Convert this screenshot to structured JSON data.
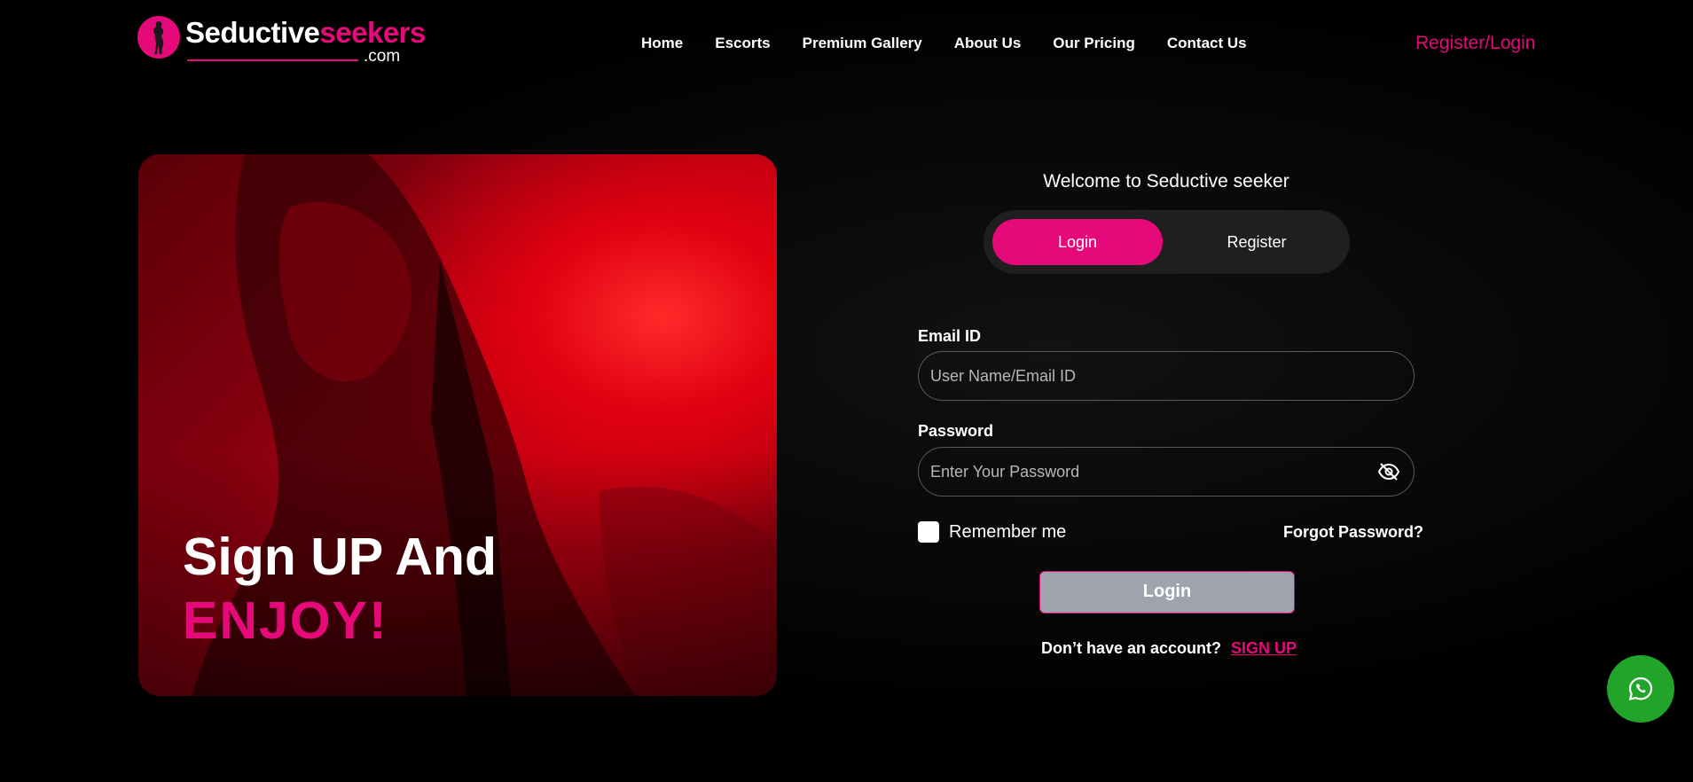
{
  "header": {
    "logo": {
      "text_white": "Seductive",
      "text_pink": "seekers",
      "suffix": ".com"
    },
    "nav": [
      "Home",
      "Escorts",
      "Premium Gallery",
      "About Us",
      "Our Pricing",
      "Contact Us"
    ],
    "register_login": "Register/Login"
  },
  "hero": {
    "line1": "Sign UP And",
    "line2": "ENJOY!"
  },
  "form": {
    "welcome": "Welcome to Seductive seeker",
    "tabs": {
      "login": "Login",
      "register": "Register"
    },
    "email": {
      "label": "Email ID",
      "placeholder": "User Name/Email ID"
    },
    "password": {
      "label": "Password",
      "placeholder": "Enter Your Password"
    },
    "remember": "Remember me",
    "forgot": "Forgot Password?",
    "submit": "Login",
    "no_account": "Don’t have an account?",
    "signup": "SIGN UP"
  },
  "colors": {
    "accent": "#e6097a",
    "background": "#000000",
    "whatsapp": "#22a42a",
    "button_disabled": "#9ea3ad"
  },
  "icons": [
    "logo-silhouette-icon",
    "eye-off-icon",
    "whatsapp-icon"
  ]
}
